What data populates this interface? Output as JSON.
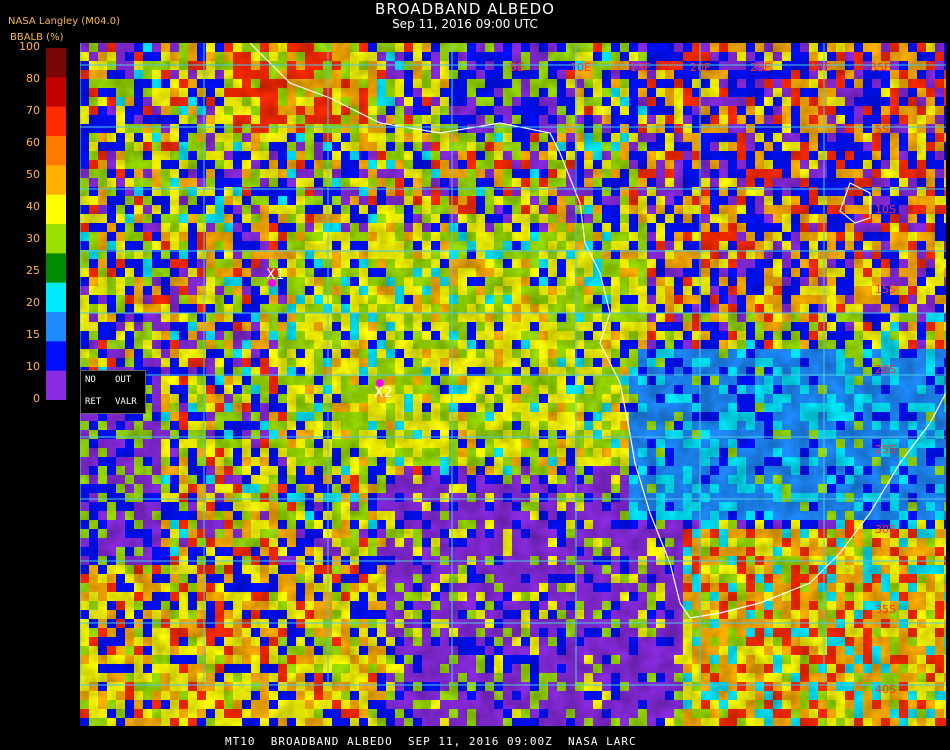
{
  "header": {
    "title": "BROADBAND ALBEDO",
    "datetime": "Sep 11, 2016 09:00 UTC",
    "source": "NASA Langley (M04.0)",
    "unit": "BBALB (%)"
  },
  "legend": {
    "ticks": [
      "100",
      "80",
      "70",
      "60",
      "50",
      "40",
      "30",
      "25",
      "20",
      "15",
      "10",
      "0"
    ],
    "colors": [
      "#7b0606",
      "#c40000",
      "#ff2a00",
      "#ff7a00",
      "#ffb000",
      "#ffff00",
      "#9be000",
      "#008c00",
      "#00eaff",
      "#1e8cff",
      "#0010ff",
      "#8a2be2"
    ]
  },
  "no_data_box": {
    "no": "NO",
    "out": "OUT",
    "ret": "RET",
    "valr": "VALR"
  },
  "map": {
    "lat_labels": [
      "5S",
      "10S",
      "15S",
      "20S",
      "25S",
      "30S",
      "35S",
      "40S"
    ],
    "lon_labels": [
      "5E",
      "10E",
      "15E",
      "20E",
      "25E",
      "30E",
      "35E"
    ],
    "markers": [
      {
        "label": "X1"
      },
      {
        "label": "X2"
      }
    ],
    "grid_color": "#4ec8e8",
    "coast_color": "#ffffff"
  },
  "footer": "MT10  BROADBAND ALBEDO  SEP 11, 2016 09:00Z  NASA LARC"
}
